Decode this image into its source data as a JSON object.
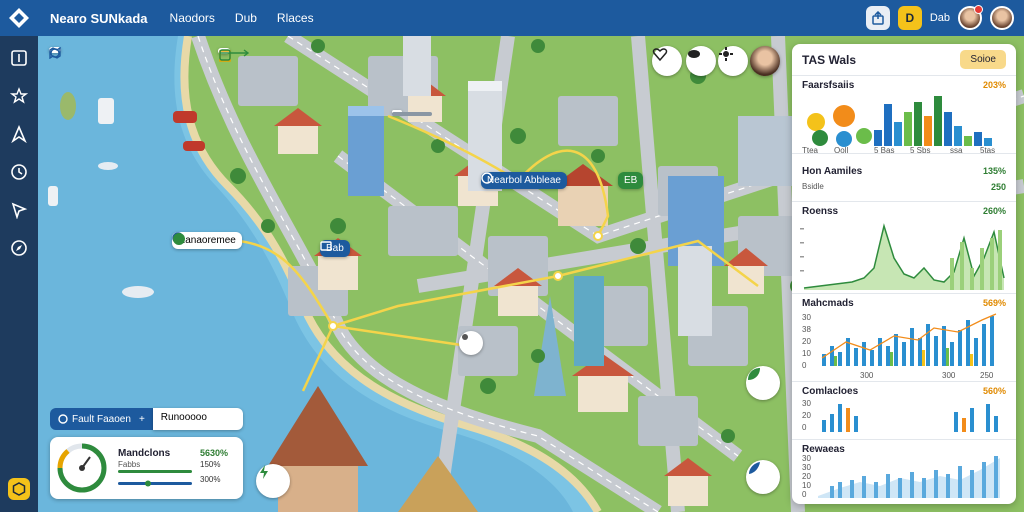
{
  "app": {
    "title": "Nearo SUNkada",
    "nav": [
      "Naodors",
      "Dub",
      "Rlaces"
    ]
  },
  "topbar": {
    "badge_label": "D",
    "user_label": "Dab"
  },
  "map": {
    "labels": {
      "top_right_search": "Nearbol Abbleae",
      "left_label": "Ranaoremee",
      "mid_label": "Bab",
      "small_badge": "EB"
    }
  },
  "panel": {
    "title": "TAS Wals",
    "action": "Soioe",
    "sections": [
      {
        "title": "Faarsfsaiis",
        "value": "203%",
        "value_color": "orange",
        "ticks": [
          "Ttea",
          "Ooll",
          "5 Bas",
          "5 Sbs",
          "ssa",
          "5tas"
        ]
      },
      {
        "title": "Hon Aamiles",
        "value": "135%",
        "sub": "Bsidle",
        "sub_value": "250"
      },
      {
        "title": "Roenss",
        "value": "260%"
      },
      {
        "title": "Mahcmads",
        "value": "569%",
        "yticks": [
          "30",
          "38",
          "20",
          "10",
          "0"
        ],
        "xticks": [
          "300",
          "300",
          "250"
        ]
      },
      {
        "title": "Comlacloes",
        "value": "560%",
        "yticks": [
          "30",
          "20",
          "0"
        ]
      },
      {
        "title": "Rewaeas",
        "yticks": [
          "30",
          "30",
          "20",
          "10",
          "0"
        ]
      }
    ]
  },
  "bottom_widget": {
    "tag": "Fault Faaoen",
    "more": "Runooooo",
    "title": "Mandclons",
    "value": "5630%",
    "rows": [
      {
        "label": "Fabbs",
        "value": "150%"
      },
      {
        "label": "",
        "value": "300%"
      }
    ]
  },
  "colors": {
    "accent": "#1d5a9e",
    "water": "#7cc4e4",
    "grass": "#8dc063",
    "road": "#c7cbd1",
    "highlight": "#f4c21a"
  }
}
